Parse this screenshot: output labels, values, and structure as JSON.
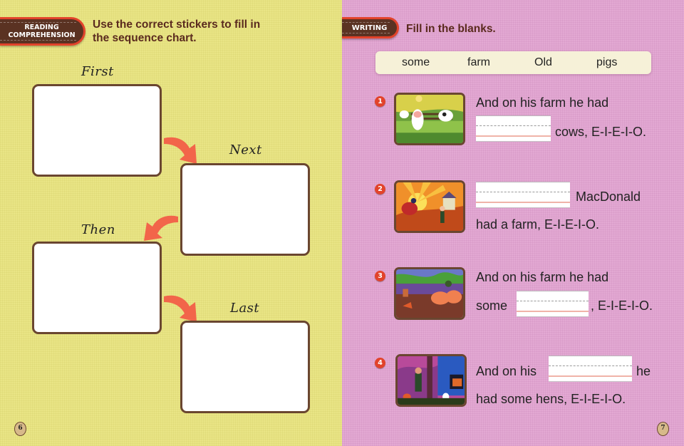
{
  "left_page": {
    "section_tab": {
      "line1": "READING",
      "line2": "COMPREHENSION"
    },
    "instruction": "Use the correct stickers to fill in the sequence chart.",
    "sequence_chart": {
      "steps": [
        {
          "label": "First"
        },
        {
          "label": "Next"
        },
        {
          "label": "Then"
        },
        {
          "label": "Last"
        }
      ],
      "arrow_icon": "curved-arrow-icon",
      "arrow_color": "#f2654a"
    },
    "page_number": "6"
  },
  "right_page": {
    "section_tab": {
      "label": "WRITING"
    },
    "instruction": "Fill in the blanks.",
    "word_bank": [
      "some",
      "farm",
      "Old",
      "pigs"
    ],
    "exercises": [
      {
        "number": "1",
        "image": "cows-farm-illustration",
        "line1": "And on his farm he had",
        "line2_after": "cows, E-I-E-I-O."
      },
      {
        "number": "2",
        "image": "rooster-sunrise-illustration",
        "line1_after": "MacDonald",
        "line2": "had a farm, E-I-E-I-O."
      },
      {
        "number": "3",
        "image": "pigs-farm-illustration",
        "line1": "And on his farm he had",
        "line2_before": "some",
        "line2_after": ", E-I-E-I-O."
      },
      {
        "number": "4",
        "image": "hens-barn-illustration",
        "line1_before": "And on his",
        "line1_after": "he",
        "line2": "had some hens, E-I-E-I-O."
      }
    ],
    "page_number": "7"
  },
  "colors": {
    "left_background": "#e9e586",
    "right_background": "#e3a9d3",
    "tab_brown": "#5a3222",
    "tab_red": "#e2432b",
    "instruction_text": "#5a2a1e",
    "arrow": "#f2654a"
  }
}
